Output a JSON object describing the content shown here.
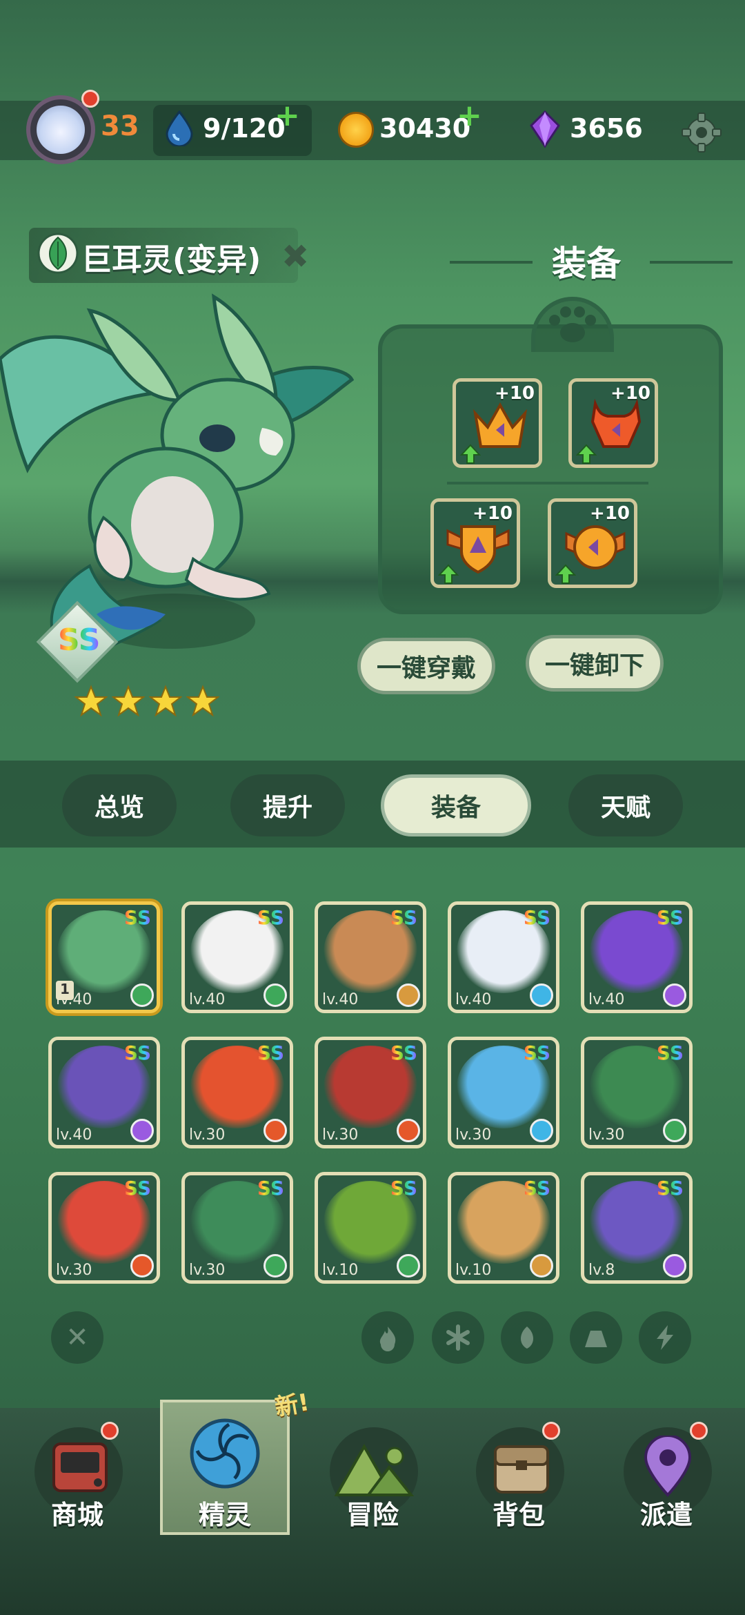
{
  "header": {
    "player_level": "33",
    "stamina": "9/120",
    "gold": "30430",
    "gems": "3656",
    "icons": [
      "avatar",
      "water-drop-icon",
      "paw-coin-icon",
      "gem-icon",
      "gear-icon"
    ]
  },
  "sprite": {
    "name": "巨耳灵(变异)",
    "element_icon": "leaf-icon",
    "rank": "SS",
    "stars": 4
  },
  "equipment": {
    "title": "装备",
    "slots": [
      {
        "icon": "crown-icon",
        "plus": "+10"
      },
      {
        "icon": "horned-armor-icon",
        "plus": "+10"
      },
      {
        "icon": "winged-shield-icon",
        "plus": "+10"
      },
      {
        "icon": "wing-orb-icon",
        "plus": "+10"
      }
    ],
    "equip_all": "一键穿戴",
    "unequip_all": "一键卸下"
  },
  "tabs": [
    "总览",
    "提升",
    "装备",
    "天赋"
  ],
  "active_tab": "装备",
  "roster": [
    {
      "lv": "lv.40",
      "ss": "SS",
      "element": "leaf",
      "color": "#5fae78",
      "selected": true,
      "badge": "1"
    },
    {
      "lv": "lv.40",
      "ss": "SS",
      "element": "leaf",
      "color": "#f2f2f2"
    },
    {
      "lv": "lv.40",
      "ss": "SS",
      "element": "earth",
      "color": "#c98a55"
    },
    {
      "lv": "lv.40",
      "ss": "SS",
      "element": "ice",
      "color": "#e8eef6"
    },
    {
      "lv": "lv.40",
      "ss": "SS",
      "element": "thunder",
      "color": "#7a4ad0"
    },
    {
      "lv": "lv.40",
      "ss": "SS",
      "element": "thunder",
      "color": "#6a53b8"
    },
    {
      "lv": "lv.30",
      "ss": "SS",
      "element": "fire",
      "color": "#e4532f"
    },
    {
      "lv": "lv.30",
      "ss": "SS",
      "element": "fire",
      "color": "#b83a32"
    },
    {
      "lv": "lv.30",
      "ss": "SS",
      "element": "ice",
      "color": "#5ab4e6"
    },
    {
      "lv": "lv.30",
      "ss": "SS",
      "element": "leaf",
      "color": "#3d8a52"
    },
    {
      "lv": "lv.30",
      "ss": "SS",
      "element": "fire",
      "color": "#de4a3a"
    },
    {
      "lv": "lv.30",
      "ss": "SS",
      "element": "leaf",
      "color": "#3e8c5a"
    },
    {
      "lv": "lv.10",
      "ss": "SS",
      "element": "leaf",
      "color": "#6fa838"
    },
    {
      "lv": "lv.10",
      "ss": "SS",
      "element": "earth",
      "color": "#d8a35e"
    },
    {
      "lv": "lv.8",
      "ss": "SS",
      "element": "thunder",
      "color": "#6d58c2"
    }
  ],
  "filters": [
    "clear-filter-icon",
    "fire-icon",
    "ice-icon",
    "leaf-icon",
    "earth-icon",
    "thunder-icon"
  ],
  "nav": [
    {
      "label": "商城",
      "icon": "shop-icon",
      "dot": true
    },
    {
      "label": "精灵",
      "icon": "sprite-swirl-icon",
      "active": true
    },
    {
      "label": "冒险",
      "icon": "mountain-icon"
    },
    {
      "label": "背包",
      "icon": "backpack-icon",
      "dot": true
    },
    {
      "label": "派遣",
      "icon": "map-pin-icon",
      "dot": true
    }
  ],
  "new_tag": "新!",
  "colors": {
    "accent": "#e6ecd2",
    "ss_red": "#e33",
    "dot": "#e1402d"
  }
}
